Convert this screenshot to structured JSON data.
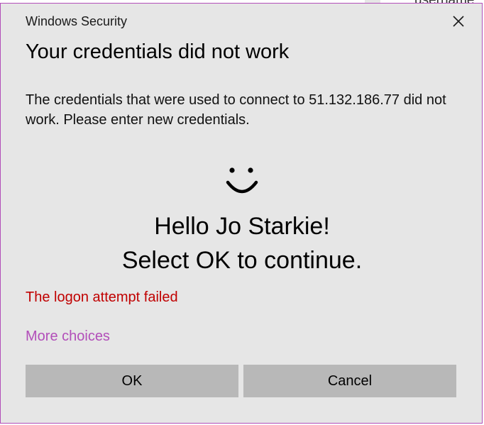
{
  "background": {
    "partial_text": "username"
  },
  "dialog": {
    "window_title": "Windows Security",
    "heading": "Your credentials did not work",
    "message": "The credentials that were used to connect to 51.132.186.77 did not work. Please enter new credentials.",
    "greeting_line1": "Hello Jo Starkie!",
    "greeting_line2": "Select OK to continue.",
    "error_text": "The logon attempt failed",
    "more_choices_label": "More choices",
    "ok_label": "OK",
    "cancel_label": "Cancel",
    "icons": {
      "close": "close-icon",
      "face": "smiley-face-icon"
    },
    "colors": {
      "accent_border": "#b24eb9",
      "link": "#b24eb9",
      "error": "#c00000",
      "button_bg": "#b8b8b8",
      "dialog_bg": "#e6e6e6"
    }
  }
}
